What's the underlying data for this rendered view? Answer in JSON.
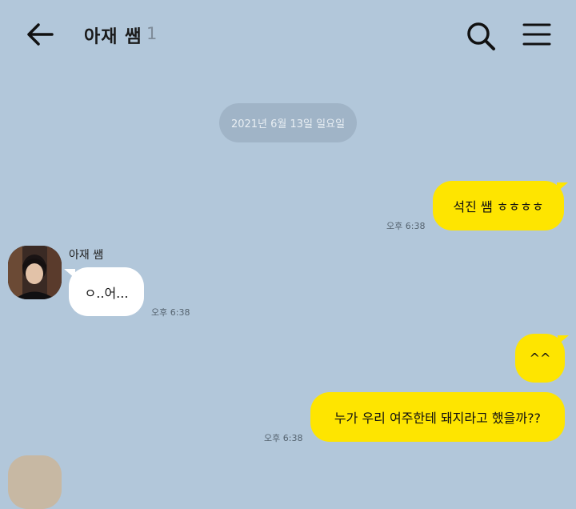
{
  "header": {
    "title": "아재 쌤",
    "member_count": "1"
  },
  "icons": {
    "back": "arrow-left-icon",
    "search": "search-icon",
    "menu": "hamburger-menu-icon"
  },
  "date_divider": "2021년 6월 13일 일요일",
  "messages": [
    {
      "from": "me",
      "text": "석진 쌤 ㅎㅎㅎㅎ",
      "time": "오후 6:38"
    },
    {
      "from": "them",
      "sender": "아재 쌤",
      "text": "ㅇ..어...",
      "time": "오후 6:38"
    },
    {
      "from": "me",
      "text": "^^",
      "time": ""
    },
    {
      "from": "me",
      "text": "누가 우리 여주한테 돼지라고 했을까??",
      "time": "오후 6:38"
    }
  ],
  "colors": {
    "background": "#b2c7da",
    "my_bubble": "#fee500",
    "their_bubble": "#ffffff",
    "date_pill": "#a0b4c7"
  }
}
